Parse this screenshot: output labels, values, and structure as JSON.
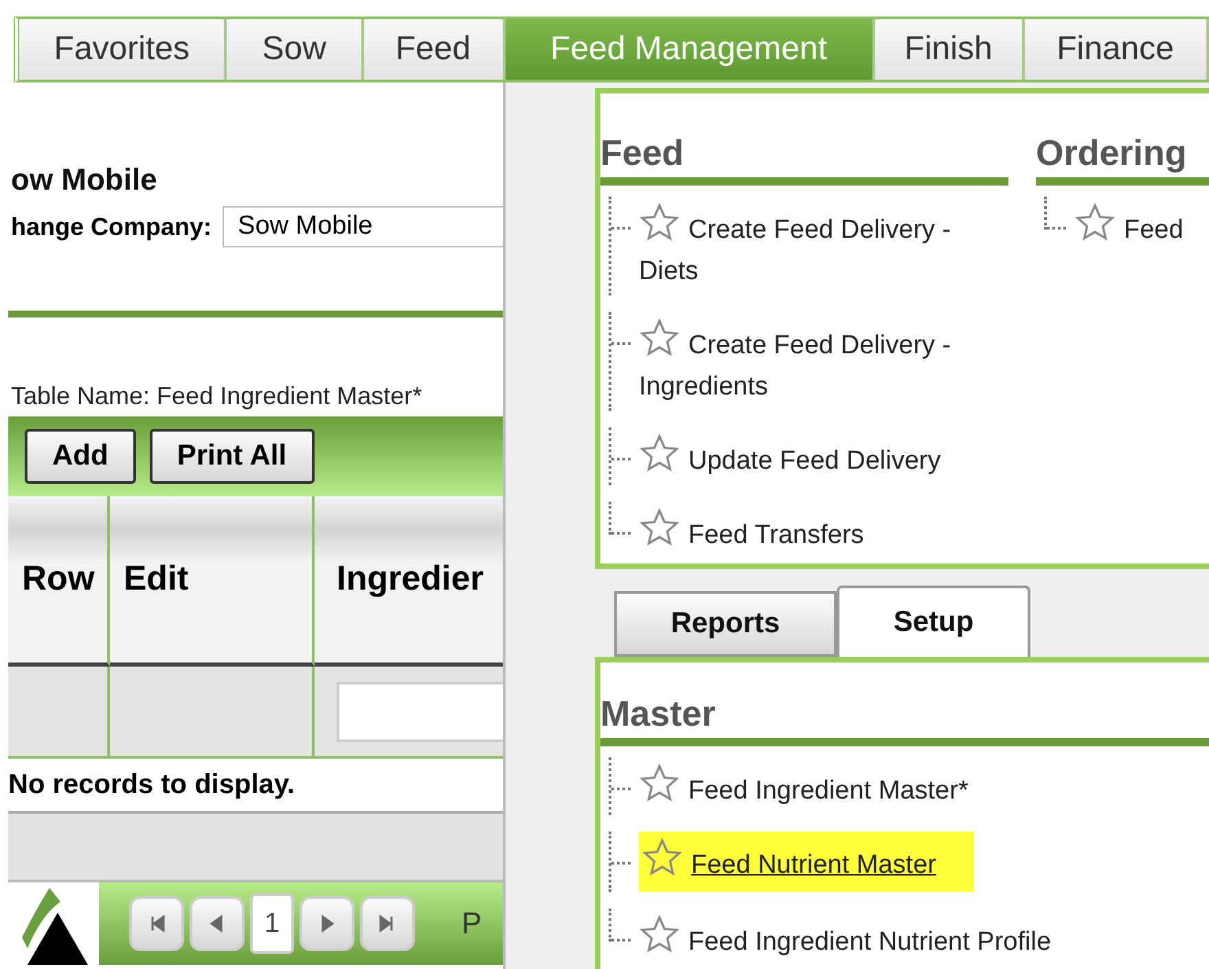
{
  "menu_tabs": [
    {
      "label": "Favorites",
      "selected": false
    },
    {
      "label": "Sow",
      "selected": false
    },
    {
      "label": "Feed",
      "selected": false
    },
    {
      "label": "Feed Management",
      "selected": true
    },
    {
      "label": "Finish",
      "selected": false
    },
    {
      "label": "Finance",
      "selected": false
    }
  ],
  "company": {
    "name": "ow Mobile",
    "change_label": "hange Company:",
    "value": "Sow Mobile"
  },
  "table_name": "Table Name: Feed Ingredient Master*",
  "toolbar_buttons": [
    "Add",
    "Print All"
  ],
  "grid": {
    "columns": [
      "Row",
      "Edit",
      "Ingredier"
    ],
    "empty_message": "No records to display."
  },
  "pager": {
    "current_page": "1",
    "label": "P"
  },
  "dropdown": {
    "sections": [
      {
        "title": "Feed",
        "items": [
          {
            "label": "Create Feed Delivery - Diets",
            "highlighted": false
          },
          {
            "label": "Create Feed Delivery - Ingredients",
            "highlighted": false
          },
          {
            "label": "Update Feed Delivery",
            "highlighted": false
          },
          {
            "label": "Feed Transfers",
            "highlighted": false
          }
        ]
      },
      {
        "title": "Ordering",
        "items": [
          {
            "label": "Feed",
            "highlighted": false
          }
        ]
      }
    ],
    "tabs": [
      {
        "label": "Reports",
        "selected": false
      },
      {
        "label": "Setup",
        "selected": true
      }
    ],
    "tab_sections": [
      {
        "title": "Master",
        "items": [
          {
            "label": "Feed Ingredient Master*",
            "highlighted": false
          },
          {
            "label": "Feed Nutrient Master",
            "highlighted": true
          },
          {
            "label": "Feed Ingredient Nutrient Profile",
            "highlighted": false
          }
        ]
      }
    ]
  }
}
